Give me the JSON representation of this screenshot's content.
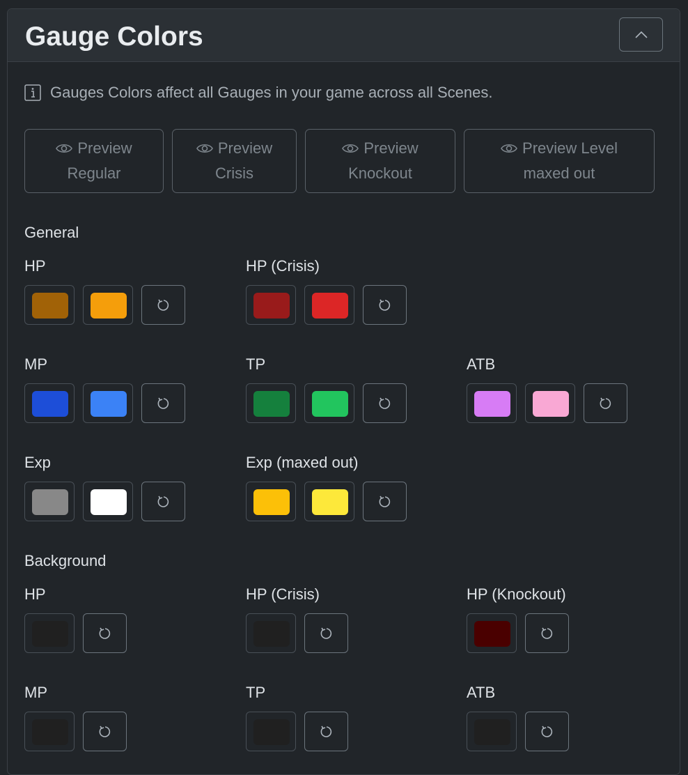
{
  "header": {
    "title": "Gauge Colors"
  },
  "info": {
    "text": "Gauges Colors affect all Gauges in your game across all Scenes."
  },
  "preview_buttons": [
    {
      "line1": "Preview",
      "line2": "Regular"
    },
    {
      "line1": "Preview",
      "line2": "Crisis"
    },
    {
      "line1": "Preview",
      "line2": "Knockout"
    },
    {
      "line1": "Preview Level",
      "line2": "maxed out"
    }
  ],
  "sections": {
    "general": "General",
    "background": "Background"
  },
  "general": {
    "hp": {
      "label": "HP",
      "colors": [
        "#a16207",
        "#f59e0b"
      ]
    },
    "hp_crisis": {
      "label": "HP (Crisis)",
      "colors": [
        "#991b1b",
        "#dc2626"
      ]
    },
    "mp": {
      "label": "MP",
      "colors": [
        "#1d4ed8",
        "#3b82f6"
      ]
    },
    "tp": {
      "label": "TP",
      "colors": [
        "#15803d",
        "#22c55e"
      ]
    },
    "atb": {
      "label": "ATB",
      "colors": [
        "#d77cf5",
        "#f9a8d4"
      ]
    },
    "exp": {
      "label": "Exp",
      "colors": [
        "#888888",
        "#ffffff"
      ]
    },
    "exp_max": {
      "label": "Exp (maxed out)",
      "colors": [
        "#fcc008",
        "#fde83a"
      ]
    }
  },
  "background": {
    "hp": {
      "label": "HP",
      "color": "#202020"
    },
    "hp_crisis": {
      "label": "HP (Crisis)",
      "color": "#202020"
    },
    "hp_knockout": {
      "label": "HP (Knockout)",
      "color": "#4a0000"
    },
    "mp": {
      "label": "MP",
      "color": "#202020"
    },
    "tp": {
      "label": "TP",
      "color": "#202020"
    },
    "atb": {
      "label": "ATB",
      "color": "#202020"
    }
  },
  "icons": {
    "collapse": "chevron-up-icon",
    "info": "info-icon",
    "preview": "eye-icon",
    "reset": "reset-icon"
  }
}
